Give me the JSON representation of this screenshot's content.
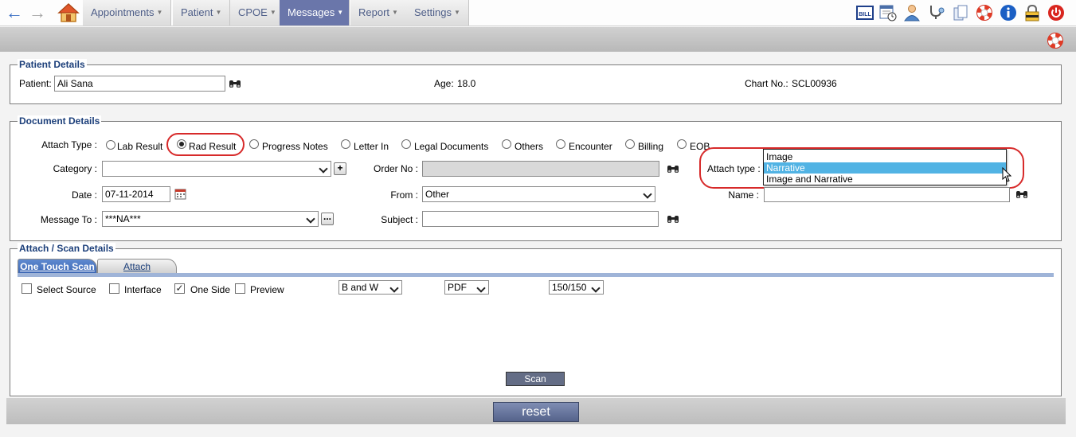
{
  "nav": {
    "back_icon": "arrow-left-icon",
    "forward_icon": "arrow-right-icon",
    "home_icon": "home-icon",
    "menus": [
      {
        "label": "Appointments"
      },
      {
        "label": "Patient"
      },
      {
        "label": "CPOE"
      },
      {
        "label": "Messages"
      },
      {
        "label": "Report"
      },
      {
        "label": "Settings"
      }
    ],
    "active_menu": "Messages",
    "bill_icon_text": "BILL",
    "toolbar_icons": [
      "bill-icon",
      "calendar-clock-icon",
      "user-icon",
      "stethoscope-icon",
      "documents-icon",
      "lifebuoy-icon",
      "info-icon",
      "lock-icon",
      "power-icon"
    ],
    "accent": "#6a76aa"
  },
  "patient_details": {
    "legend": "Patient Details",
    "patient_label": "Patient:",
    "patient_value": "Ali Sana",
    "age_label": "Age:",
    "age_value": "18.0",
    "chart_label": "Chart No.:",
    "chart_value": "SCL00936"
  },
  "document_details": {
    "legend": "Document Details",
    "attach_type_label": "Attach Type :",
    "attach_types": [
      "Lab Result",
      "Rad Result",
      "Progress Notes",
      "Letter In",
      "Legal Documents",
      "Others",
      "Encounter",
      "Billing",
      "EOB"
    ],
    "attach_type_selected": "Rad Result",
    "category_label": "Category :",
    "category_value": "",
    "order_no_label": "Order No :",
    "order_no_value": "",
    "attach_type2_label": "Attach type :",
    "attach_type2_options": [
      "Image",
      "Narrative",
      "Image and Narrative"
    ],
    "attach_type2_highlighted": "Narrative",
    "date_label": "Date :",
    "date_value": "07-11-2014",
    "from_label": "From :",
    "from_value": "Other",
    "name_label": "Name :",
    "name_value": "",
    "message_to_label": "Message To :",
    "message_to_value": "***NA***",
    "subject_label": "Subject :",
    "subject_value": "",
    "callout_color": "#d72a2a"
  },
  "scan_details": {
    "legend": "Attach / Scan Details",
    "tabs": [
      "One Touch Scan",
      "Attach"
    ],
    "active_tab": "One Touch Scan",
    "options": [
      {
        "label": "Select Source",
        "checked": false
      },
      {
        "label": "Interface",
        "checked": false
      },
      {
        "label": "One Side",
        "checked": true
      },
      {
        "label": "Preview",
        "checked": false
      }
    ],
    "color_mode": "B and W",
    "format": "PDF",
    "resolution": "150/150",
    "scan_button": "Scan"
  },
  "footer": {
    "reset_button": "reset"
  }
}
